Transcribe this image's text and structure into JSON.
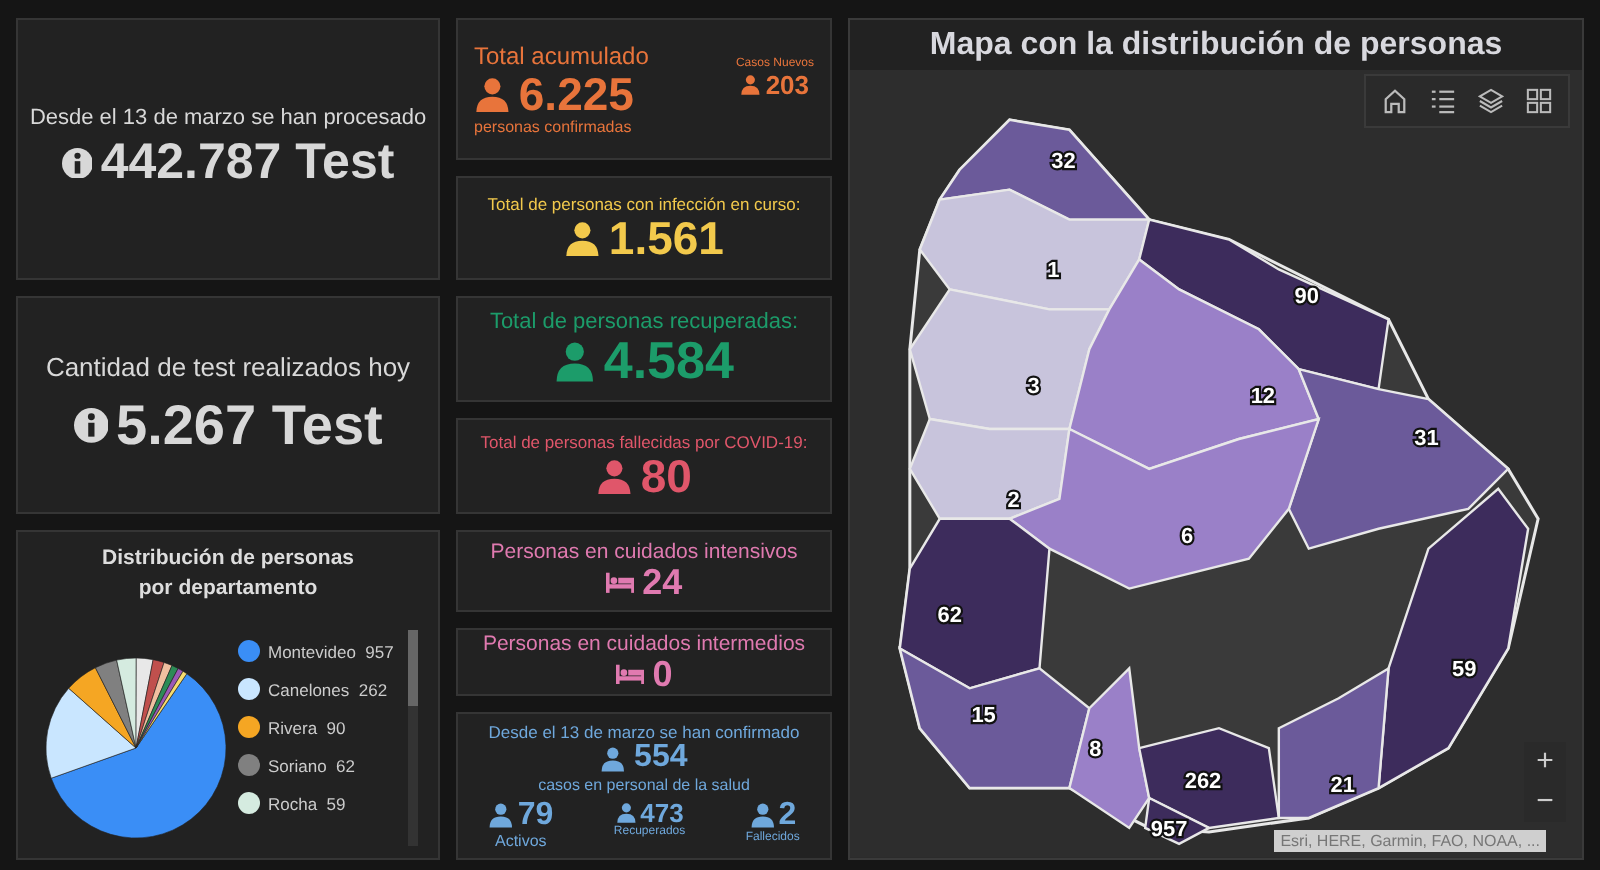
{
  "test_cards": [
    {
      "caption": "Desde el 13 de marzo se han procesado",
      "value": "442.787 Test"
    },
    {
      "caption": "Cantidad de test realizados hoy",
      "value": "5.267 Test"
    }
  ],
  "department_chart": {
    "title": "Distribución de personas por departamento",
    "legend": [
      {
        "label": "Montevideo",
        "count": "957",
        "color": "#3a8ef6"
      },
      {
        "label": "Canelones",
        "count": "262",
        "color": "#c9e6ff"
      },
      {
        "label": "Rivera",
        "count": "90",
        "color": "#f5a623"
      },
      {
        "label": "Soriano",
        "count": "62",
        "color": "#808080"
      },
      {
        "label": "Rocha",
        "count": "59",
        "color": "#d5ebe0"
      }
    ]
  },
  "indicators": [
    {
      "kind": "total",
      "title": "Total acumulado",
      "value": "6.225",
      "subtitle": "personas confirmadas",
      "new_label": "Casos Nuevos",
      "new_value": "203",
      "color": "#e8743b"
    },
    {
      "kind": "person",
      "title": "Total de personas con infección en curso:",
      "value": "1.561",
      "color": "#f2c94c"
    },
    {
      "kind": "person",
      "title": "Total de personas recuperadas:",
      "value": "4.584",
      "color": "#1c9c6a"
    },
    {
      "kind": "person",
      "title": "Total de personas fallecidas por COVID-19:",
      "value": "80",
      "color": "#e0566a"
    },
    {
      "kind": "bed",
      "title": "Personas en cuidados intensivos",
      "value": "24",
      "color": "#e07ab0"
    },
    {
      "kind": "bed",
      "title": "Personas en cuidados intermedios",
      "value": "0",
      "color": "#e07ab0"
    },
    {
      "kind": "health",
      "title": "Desde el 13 de marzo se han confirmado",
      "value": "554",
      "subtitle": "casos en personal de la salud",
      "color": "#6fa8dc",
      "breakdown": [
        {
          "value": "79",
          "label": "Activos"
        },
        {
          "value": "473",
          "label": "Recuperados"
        },
        {
          "value": "2",
          "label": "Fallecidos"
        }
      ]
    }
  ],
  "map": {
    "title": "Mapa con la distribución de personas",
    "departments": [
      {
        "label": "32",
        "color": "#6b5a9a"
      },
      {
        "label": "1",
        "color": "#c8c4dc"
      },
      {
        "label": "90",
        "color": "#3d2c5c"
      },
      {
        "label": "3",
        "color": "#c8c4dc"
      },
      {
        "label": "12",
        "color": "#9a80c8"
      },
      {
        "label": "31",
        "color": "#6b5a9a"
      },
      {
        "label": "2",
        "color": "#c8c4dc"
      },
      {
        "label": "6",
        "color": "#9a80c8"
      },
      {
        "label": "62",
        "color": "#3d2c5c"
      },
      {
        "label": "59",
        "color": "#3d2c5c"
      },
      {
        "label": "15",
        "color": "#6b5a9a"
      },
      {
        "label": "8",
        "color": "#9a80c8"
      },
      {
        "label": "262",
        "color": "#3d2c5c"
      },
      {
        "label": "21",
        "color": "#6b5a9a"
      },
      {
        "label": "957",
        "color": "#3d2c5c"
      }
    ],
    "attribution": "Esri, HERE, Garmin, FAO, NOAA, ...",
    "zoom_in": "+",
    "zoom_out": "−"
  }
}
